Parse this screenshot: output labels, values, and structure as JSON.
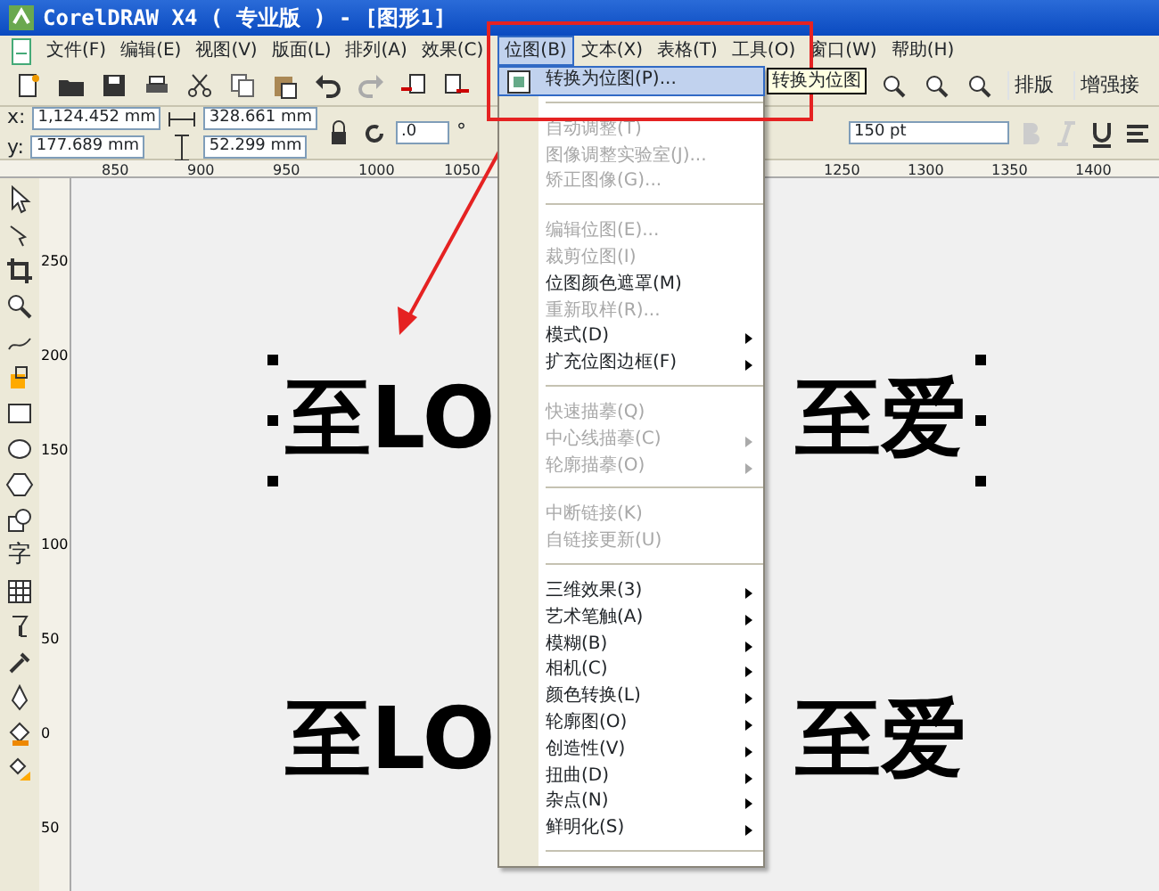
{
  "window": {
    "title": "CorelDRAW X4 ( 专业版 ) - [图形1]"
  },
  "menubar": [
    {
      "label": "文件(F)",
      "selected": false
    },
    {
      "label": "编辑(E)",
      "selected": false
    },
    {
      "label": "视图(V)",
      "selected": false
    },
    {
      "label": "版面(L)",
      "selected": false
    },
    {
      "label": "排列(A)",
      "selected": false
    },
    {
      "label": "效果(C)",
      "selected": false
    },
    {
      "label": "位图(B)",
      "selected": true
    },
    {
      "label": "文本(X)",
      "selected": false
    },
    {
      "label": "表格(T)",
      "selected": false
    },
    {
      "label": "工具(O)",
      "selected": false
    },
    {
      "label": "窗口(W)",
      "selected": false
    },
    {
      "label": "帮助(H)",
      "selected": false
    }
  ],
  "toolbar": {
    "buttons": [
      "排版",
      "增强接"
    ]
  },
  "property_bar": {
    "x": "1,124.452 mm",
    "y": "177.689 mm",
    "width": "328.661 mm",
    "height": "52.299 mm",
    "x_label": "x:",
    "y_label": "y:",
    "rotation": ".0",
    "degree": "°",
    "font_size": "150 pt"
  },
  "ruler": {
    "left_ticks": [
      "850",
      "900",
      "950",
      "1000",
      "1050"
    ],
    "right_ticks": [
      "1250",
      "1300",
      "1350",
      "1400"
    ],
    "vertical_ticks": [
      "250",
      "200",
      "150",
      "100",
      "50",
      "0",
      "50"
    ]
  },
  "toolbox": {
    "text_tool": "字"
  },
  "canvas": {
    "texts": [
      {
        "left": "至LO",
        "right": "至爱",
        "selected": true
      },
      {
        "left": "至LO",
        "right": "至爱",
        "selected": false
      }
    ]
  },
  "tooltip": "转换为位图",
  "bitmap_menu": [
    {
      "kind": "item",
      "label": "转换为位图(P)...",
      "disabled": false,
      "submenu": false,
      "selected": true
    },
    {
      "kind": "separator"
    },
    {
      "kind": "item",
      "label": "自动调整(T)",
      "disabled": true,
      "submenu": false,
      "selected": false
    },
    {
      "kind": "item",
      "label": "图像调整实验室(J)...",
      "disabled": true,
      "submenu": false,
      "selected": false
    },
    {
      "kind": "item",
      "label": "矫正图像(G)...",
      "disabled": true,
      "submenu": false,
      "selected": false
    },
    {
      "kind": "separator"
    },
    {
      "kind": "item",
      "label": "编辑位图(E)...",
      "disabled": true,
      "submenu": false,
      "selected": false
    },
    {
      "kind": "item",
      "label": "裁剪位图(I)",
      "disabled": true,
      "submenu": false,
      "selected": false
    },
    {
      "kind": "item",
      "label": "位图颜色遮罩(M)",
      "disabled": false,
      "submenu": false,
      "selected": false
    },
    {
      "kind": "item",
      "label": "重新取样(R)...",
      "disabled": true,
      "submenu": false,
      "selected": false
    },
    {
      "kind": "item",
      "label": "模式(D)",
      "disabled": false,
      "submenu": true,
      "selected": false
    },
    {
      "kind": "item",
      "label": "扩充位图边框(F)",
      "disabled": false,
      "submenu": true,
      "selected": false
    },
    {
      "kind": "separator"
    },
    {
      "kind": "item",
      "label": "快速描摹(Q)",
      "disabled": true,
      "submenu": false,
      "selected": false
    },
    {
      "kind": "item",
      "label": "中心线描摹(C)",
      "disabled": true,
      "submenu": true,
      "selected": false
    },
    {
      "kind": "item",
      "label": "轮廓描摹(O)",
      "disabled": true,
      "submenu": true,
      "selected": false
    },
    {
      "kind": "separator"
    },
    {
      "kind": "item",
      "label": "中断链接(K)",
      "disabled": true,
      "submenu": false,
      "selected": false
    },
    {
      "kind": "item",
      "label": "自链接更新(U)",
      "disabled": true,
      "submenu": false,
      "selected": false
    },
    {
      "kind": "separator"
    },
    {
      "kind": "item",
      "label": "三维效果(3)",
      "disabled": false,
      "submenu": true,
      "selected": false
    },
    {
      "kind": "item",
      "label": "艺术笔触(A)",
      "disabled": false,
      "submenu": true,
      "selected": false
    },
    {
      "kind": "item",
      "label": "模糊(B)",
      "disabled": false,
      "submenu": true,
      "selected": false
    },
    {
      "kind": "item",
      "label": "相机(C)",
      "disabled": false,
      "submenu": true,
      "selected": false
    },
    {
      "kind": "item",
      "label": "颜色转换(L)",
      "disabled": false,
      "submenu": true,
      "selected": false
    },
    {
      "kind": "item",
      "label": "轮廓图(O)",
      "disabled": false,
      "submenu": true,
      "selected": false
    },
    {
      "kind": "item",
      "label": "创造性(V)",
      "disabled": false,
      "submenu": true,
      "selected": false
    },
    {
      "kind": "item",
      "label": "扭曲(D)",
      "disabled": false,
      "submenu": true,
      "selected": false
    },
    {
      "kind": "item",
      "label": "杂点(N)",
      "disabled": false,
      "submenu": true,
      "selected": false
    },
    {
      "kind": "item",
      "label": "鲜明化(S)",
      "disabled": false,
      "submenu": true,
      "selected": false
    },
    {
      "kind": "separator"
    }
  ]
}
